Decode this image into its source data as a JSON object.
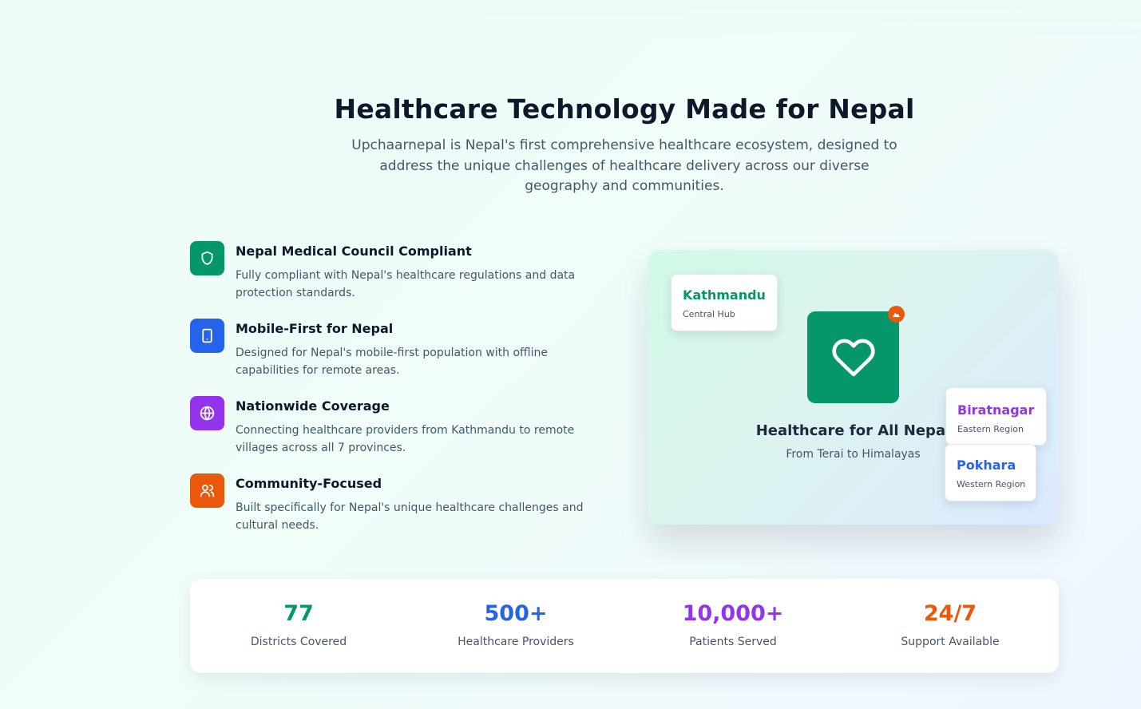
{
  "hero": {
    "title": "Healthcare Technology Made for Nepal",
    "subtitle": "Upchaarnepal is Nepal's first comprehensive healthcare ecosystem, designed to address the unique challenges of healthcare delivery across our diverse geography and communities."
  },
  "features": [
    {
      "icon": "shield-icon",
      "color": "#059669",
      "title": "Nepal Medical Council Compliant",
      "description": "Fully compliant with Nepal's healthcare regulations and data protection standards."
    },
    {
      "icon": "smartphone-icon",
      "color": "#2563eb",
      "title": "Mobile-First for Nepal",
      "description": "Designed for Nepal's mobile-first population with offline capabilities for remote areas."
    },
    {
      "icon": "globe-icon",
      "color": "#9333ea",
      "title": "Nationwide Coverage",
      "description": "Connecting healthcare providers from Kathmandu to remote villages across all 7 provinces."
    },
    {
      "icon": "users-icon",
      "color": "#ea580c",
      "title": "Community-Focused",
      "description": "Built specifically for Nepal's unique healthcare challenges and cultural needs."
    }
  ],
  "visual": {
    "icon": "heart-icon",
    "badge_icon": "mountain-icon",
    "title": "Healthcare for All Nepal",
    "subtitle": "From Terai to Himalayas",
    "cities": [
      {
        "name": "Kathmandu",
        "region": "Central Hub",
        "color": "#059669"
      },
      {
        "name": "Biratnagar",
        "region": "Eastern Region",
        "color": "#9333ea"
      },
      {
        "name": "Pokhara",
        "region": "Western Region",
        "color": "#2563eb"
      }
    ]
  },
  "stats": [
    {
      "value": "77",
      "label": "Districts Covered",
      "color": "#059669"
    },
    {
      "value": "500+",
      "label": "Healthcare Providers",
      "color": "#2563eb"
    },
    {
      "value": "10,000+",
      "label": "Patients Served",
      "color": "#9333ea"
    },
    {
      "value": "24/7",
      "label": "Support Available",
      "color": "#ea580c"
    }
  ]
}
